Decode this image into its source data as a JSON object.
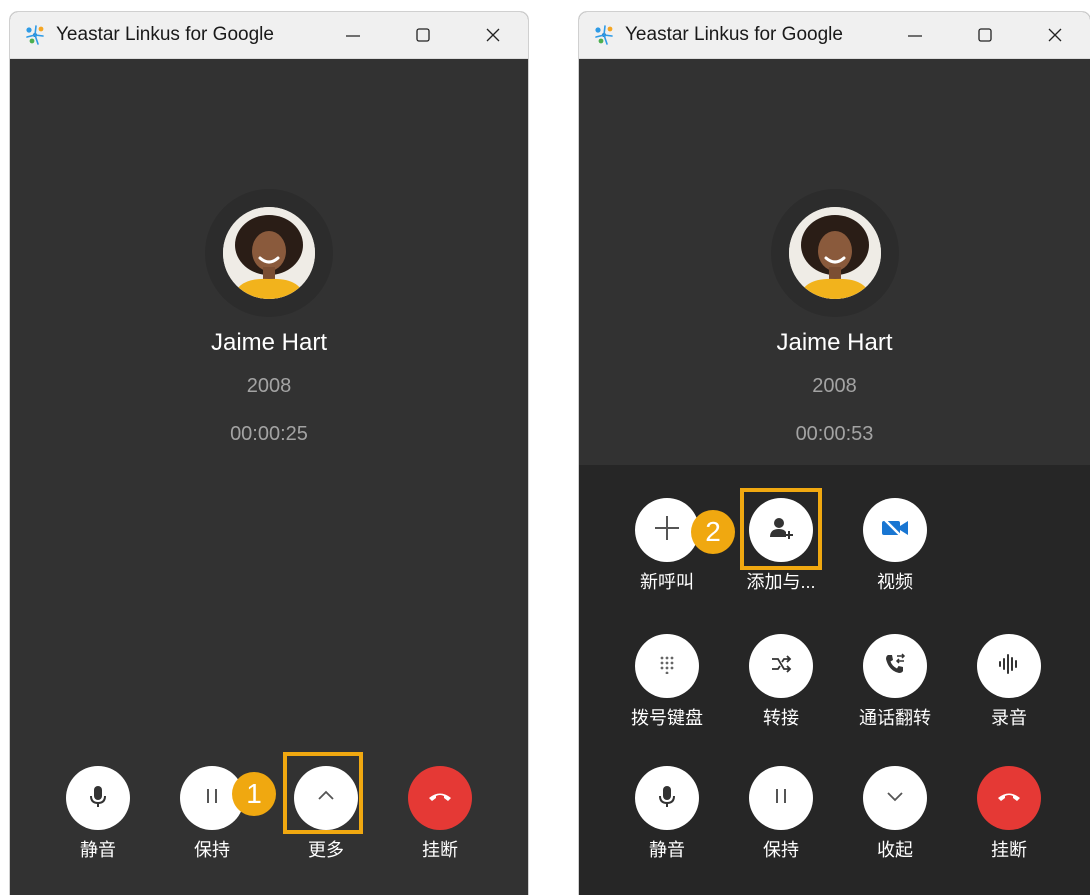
{
  "window1": {
    "title": "Yeastar Linkus for Google",
    "caller": {
      "name": "Jaime Hart",
      "extension": "2008",
      "timer": "00:00:25"
    },
    "controls": [
      {
        "label": "静音",
        "icon": "microphone-icon"
      },
      {
        "label": "保持",
        "icon": "pause-icon"
      },
      {
        "label": "更多",
        "icon": "chevron-up-icon"
      },
      {
        "label": "挂断",
        "icon": "hang-up-icon"
      }
    ],
    "step_badge": "1"
  },
  "window2": {
    "title": "Yeastar Linkus for Google",
    "caller": {
      "name": "Jaime Hart",
      "extension": "2008",
      "timer": "00:00:53"
    },
    "more_controls_row1": [
      {
        "label": "新呼叫",
        "icon": "plus-icon"
      },
      {
        "label": "添加与...",
        "icon": "add-participant-icon"
      },
      {
        "label": "视频",
        "icon": "video-off-icon"
      }
    ],
    "more_controls_row2": [
      {
        "label": "拨号键盘",
        "icon": "dialpad-icon"
      },
      {
        "label": "转接",
        "icon": "transfer-icon"
      },
      {
        "label": "通话翻转",
        "icon": "call-flip-icon"
      },
      {
        "label": "录音",
        "icon": "record-icon"
      }
    ],
    "controls": [
      {
        "label": "静音",
        "icon": "microphone-icon"
      },
      {
        "label": "保持",
        "icon": "pause-icon"
      },
      {
        "label": "收起",
        "icon": "chevron-down-icon"
      },
      {
        "label": "挂断",
        "icon": "hang-up-icon"
      }
    ],
    "step_badge": "2"
  },
  "colors": {
    "accent": "#f0a810",
    "hangup": "#e53935",
    "background": "#323232",
    "panel": "#262626"
  }
}
